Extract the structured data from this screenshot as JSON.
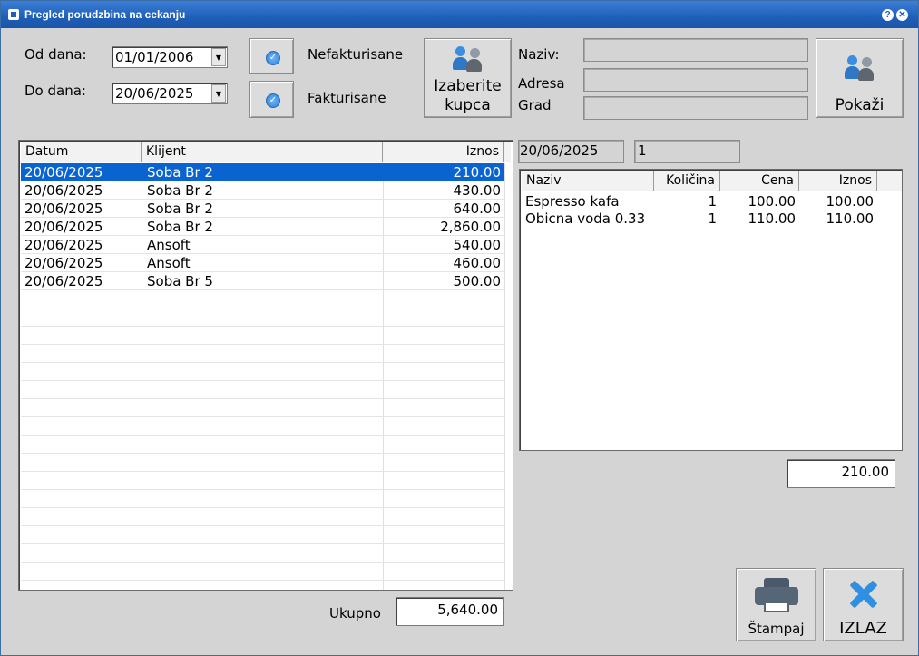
{
  "window": {
    "title": "Pregled porudzbina na cekanju",
    "help_glyph": "?",
    "close_glyph": "✕"
  },
  "filters": {
    "from_label": "Od dana:",
    "from_value": "01/01/2006",
    "to_label": "Do dana:",
    "to_value": "20/06/2025",
    "unbilled_label": "Nefakturisane",
    "billed_label": "Fakturisane"
  },
  "customer": {
    "select_button_line1": "Izaberite",
    "select_button_line2": "kupca",
    "name_label": "Naziv:",
    "address_label": "Adresa",
    "city_label": "Grad",
    "show_button": "Pokaži"
  },
  "orders": {
    "columns": [
      "Datum",
      "Klijent",
      "Iznos"
    ],
    "rows": [
      {
        "date": "20/06/2025",
        "client": "Soba Br 2",
        "amount": "210.00"
      },
      {
        "date": "20/06/2025",
        "client": "Soba Br 2",
        "amount": "430.00"
      },
      {
        "date": "20/06/2025",
        "client": "Soba Br 2",
        "amount": "640.00"
      },
      {
        "date": "20/06/2025",
        "client": "Soba Br 2",
        "amount": "2,860.00"
      },
      {
        "date": "20/06/2025",
        "client": "Ansoft",
        "amount": "540.00"
      },
      {
        "date": "20/06/2025",
        "client": "Ansoft",
        "amount": "460.00"
      },
      {
        "date": "20/06/2025",
        "client": "Soba Br 5",
        "amount": "500.00"
      }
    ],
    "selected_index": 0,
    "total_label": "Ukupno",
    "total_value": "5,640.00"
  },
  "detail": {
    "date": "20/06/2025",
    "number": "1",
    "columns": [
      "Naziv",
      "Količina",
      "Cena",
      "Iznos"
    ],
    "items": [
      {
        "name": "Espresso kafa",
        "qty": "1",
        "price": "100.00",
        "amount": "100.00"
      },
      {
        "name": "Obicna voda 0.33",
        "qty": "1",
        "price": "110.00",
        "amount": "110.00"
      }
    ],
    "total": "210.00"
  },
  "actions": {
    "print_label": "Štampaj",
    "exit_label": "IZLAZ"
  },
  "colors": {
    "title_bar": "#1f5fb8",
    "selection": "#0a64d0",
    "window_bg": "#d4d4d4"
  }
}
